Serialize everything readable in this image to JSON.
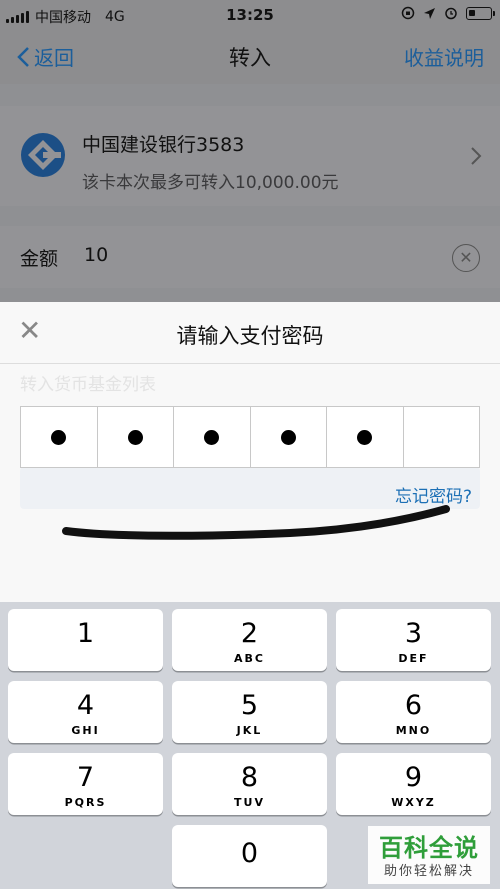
{
  "status_bar": {
    "carrier": "中国移动",
    "network": "4G",
    "time": "13:25"
  },
  "nav": {
    "back_label": "返回",
    "title": "转入",
    "right_label": "收益说明"
  },
  "bank_card": {
    "name": "中国建设银行3583",
    "limit_text": "该卡本次最多可转入10,000.00元"
  },
  "amount": {
    "label": "金额",
    "value": "10"
  },
  "background_hints": {
    "fund_list_text": "转入货币基金列表"
  },
  "password_sheet": {
    "title": "请输入支付密码",
    "close_symbol": "✕",
    "pin_length": 6,
    "digits_entered": 5,
    "forgot_label": "忘记密码?"
  },
  "keyboard": {
    "keys": [
      {
        "num": "1",
        "letters": ""
      },
      {
        "num": "2",
        "letters": "ABC"
      },
      {
        "num": "3",
        "letters": "DEF"
      },
      {
        "num": "4",
        "letters": "GHI"
      },
      {
        "num": "5",
        "letters": "JKL"
      },
      {
        "num": "6",
        "letters": "MNO"
      },
      {
        "num": "7",
        "letters": "PQRS"
      },
      {
        "num": "8",
        "letters": "TUV"
      },
      {
        "num": "9",
        "letters": "WXYZ"
      },
      {
        "num": "0",
        "letters": ""
      }
    ]
  },
  "watermark": {
    "title": "百科全说",
    "subtitle": "助你轻松解决"
  },
  "colors": {
    "link_blue": "#1b6fb5",
    "overlay_gray": "#8f9093",
    "watermark_green": "#2f9e3a"
  }
}
